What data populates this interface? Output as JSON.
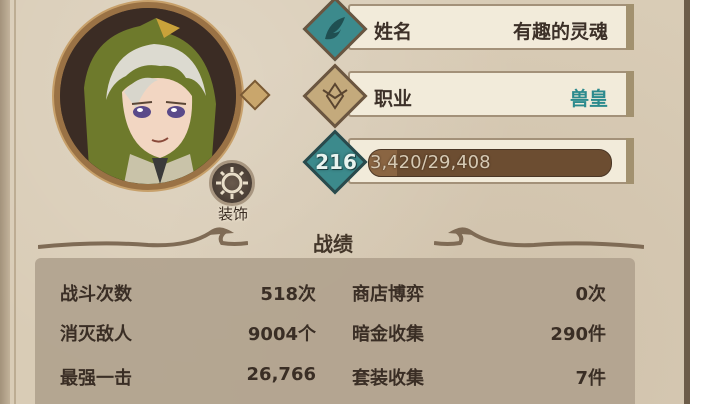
{
  "profile": {
    "name_label": "姓名",
    "name_value": "有趣的灵魂",
    "job_label": "职业",
    "job_value": "兽皇",
    "level": "216",
    "xp_text": "3,420/29,408",
    "xp_progress": 0.116,
    "decoration_label": "装饰"
  },
  "stats": {
    "title": "战绩",
    "left": [
      {
        "label": "战斗次数",
        "value": "518次"
      },
      {
        "label": "消灭敌人",
        "value": "9004个"
      },
      {
        "label": "最强一击",
        "value": "26,766"
      }
    ],
    "right": [
      {
        "label": "商店博弈",
        "value": "0次"
      },
      {
        "label": "暗金收集",
        "value": "290件"
      },
      {
        "label": "套装收集",
        "value": "7件"
      }
    ]
  },
  "colors": {
    "panel_bg": "#d9ccb6",
    "accent_teal": "#2c8a8d",
    "frame_bronze": "#9a7245",
    "xp_bar": "#6c4d31"
  },
  "icons": {
    "name_emblem": "feather-leaf-icon",
    "job_emblem": "winged-crest-icon",
    "level_emblem": "level-diamond-icon",
    "decoration": "gear-icon"
  }
}
